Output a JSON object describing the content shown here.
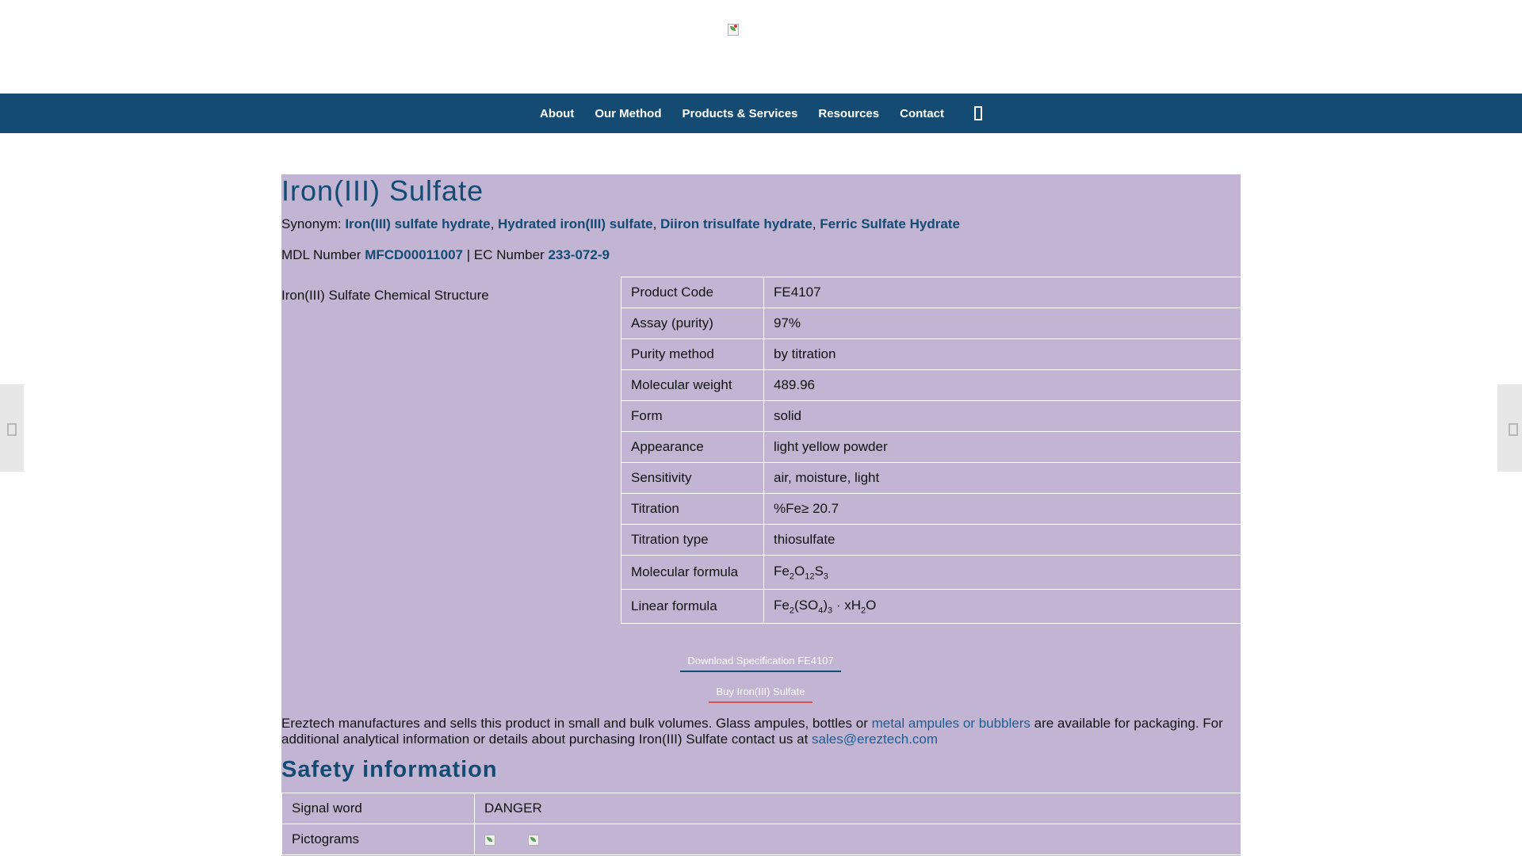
{
  "nav": {
    "items": [
      "About",
      "Our Method",
      "Products & Services",
      "Resources",
      "Contact"
    ]
  },
  "product": {
    "title": "Iron(III) Sulfate",
    "synonym_label": "Synonym:",
    "synonyms": [
      "Iron(III) sulfate hydrate",
      "Hydrated iron(III) sulfate",
      "Diiron trisulfate hydrate",
      "Ferric Sulfate Hydrate"
    ],
    "mdl_label": "MDL Number",
    "mdl_value": "MFCD00011007",
    "separator": "|",
    "ec_label": "EC Number",
    "ec_value": "233-072-9",
    "structure_alt": "Iron(III) Sulfate Chemical Structure"
  },
  "properties": [
    {
      "key": "Product Code",
      "value": "FE4107"
    },
    {
      "key": "Assay (purity)",
      "value": "97%"
    },
    {
      "key": "Purity method",
      "value": "by titration"
    },
    {
      "key": "Molecular weight",
      "value": "489.96"
    },
    {
      "key": "Form",
      "value": "solid"
    },
    {
      "key": "Appearance",
      "value": "light yellow powder"
    },
    {
      "key": "Sensitivity",
      "value": "air, moisture, light"
    },
    {
      "key": "Titration",
      "value": "%Fe≥ 20.7"
    },
    {
      "key": "Titration type",
      "value": "thiosulfate"
    }
  ],
  "formulas": {
    "molecular_label": "Molecular formula",
    "linear_label": "Linear formula"
  },
  "buttons": {
    "spec": "Download Specification FE4107",
    "buy": "Buy Iron(III) Sulfate"
  },
  "description": {
    "part1": "Ereztech manufactures and sells this product in small and bulk volumes. Glass ampules, bottles or ",
    "link1": "metal ampules or bubblers",
    "part2": " are available for packaging. For additional analytical information or details about purchasing Iron(III) Sulfate contact us at ",
    "email": "sales@ereztech.com"
  },
  "safety": {
    "heading": "Safety information",
    "signal_label": "Signal word",
    "signal_value": "DANGER",
    "pictograms_label": "Pictograms"
  },
  "colors": {
    "nav_bg": "#134b73",
    "content_bg": "#c2b5d4",
    "accent": "#134b73",
    "buy_underline": "#d9534f"
  }
}
